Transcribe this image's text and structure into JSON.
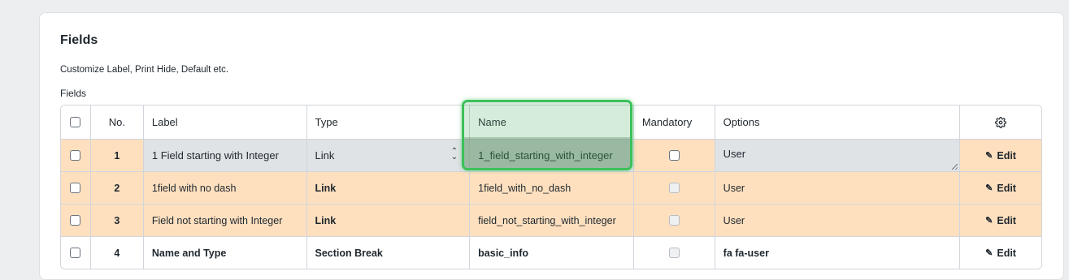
{
  "section": {
    "title": "Fields",
    "description": "Customize Label, Print Hide, Default etc.",
    "grid_label": "Fields"
  },
  "columns": {
    "no": "No.",
    "label": "Label",
    "type": "Type",
    "name": "Name",
    "mandatory": "Mandatory",
    "options": "Options",
    "settings_icon": "gear-icon"
  },
  "rows": [
    {
      "no": "1",
      "label": "1 Field starting with Integer",
      "type": "Link",
      "name": "1_field_starting_with_integer",
      "options": "User",
      "edit": "Edit"
    },
    {
      "no": "2",
      "label": "1field with no dash",
      "type": "Link",
      "name": "1field_with_no_dash",
      "options": "User",
      "edit": "Edit"
    },
    {
      "no": "3",
      "label": "Field not starting with Integer",
      "type": "Link",
      "name": "field_not_starting_with_integer",
      "options": "User",
      "edit": "Edit"
    },
    {
      "no": "4",
      "label": "Name and Type",
      "type": "Section Break",
      "name": "basic_info",
      "options": "fa fa-user",
      "edit": "Edit"
    }
  ],
  "colors": {
    "row_highlight": "#fee0bf",
    "editing_bg": "#dfe3e6",
    "focus_ring": "#3cc15a"
  }
}
